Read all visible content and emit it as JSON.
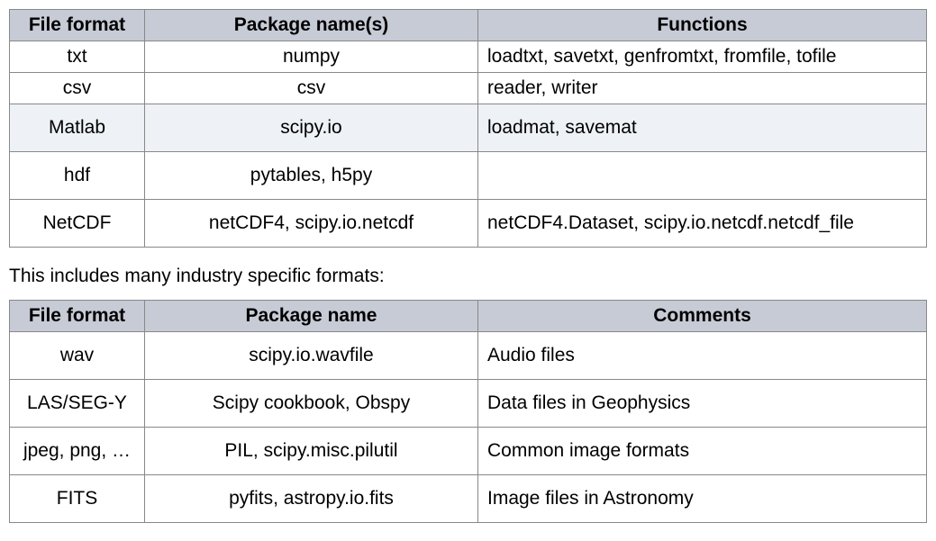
{
  "table1": {
    "headers": [
      "File format",
      "Package name(s)",
      "Functions"
    ],
    "rows": [
      {
        "format": "txt",
        "package": "numpy",
        "functions": "loadtxt, savetxt, genfromtxt, fromfile, tofile",
        "highlight": false,
        "tall": false
      },
      {
        "format": "csv",
        "package": "csv",
        "functions": "reader, writer",
        "highlight": false,
        "tall": false
      },
      {
        "format": "Matlab",
        "package": "scipy.io",
        "functions": "loadmat, savemat",
        "highlight": true,
        "tall": true
      },
      {
        "format": "hdf",
        "package": "pytables, h5py",
        "functions": "",
        "highlight": false,
        "tall": true
      },
      {
        "format": "NetCDF",
        "package": "netCDF4, scipy.io.netcdf",
        "functions": "netCDF4.Dataset, scipy.io.netcdf.netcdf_file",
        "highlight": false,
        "tall": true
      }
    ]
  },
  "caption": "This includes many industry specific formats:",
  "table2": {
    "headers": [
      "File format",
      "Package name",
      "Comments"
    ],
    "rows": [
      {
        "format": "wav",
        "package": "scipy.io.wavfile",
        "comments": "Audio files"
      },
      {
        "format": "LAS/SEG-Y",
        "package": "Scipy cookbook, Obspy",
        "comments": "Data files in Geophysics"
      },
      {
        "format": "jpeg, png, …",
        "package": "PIL, scipy.misc.pilutil",
        "comments": "Common image formats"
      },
      {
        "format": "FITS",
        "package": "pyfits, astropy.io.fits",
        "comments": "Image files in Astronomy"
      }
    ]
  }
}
